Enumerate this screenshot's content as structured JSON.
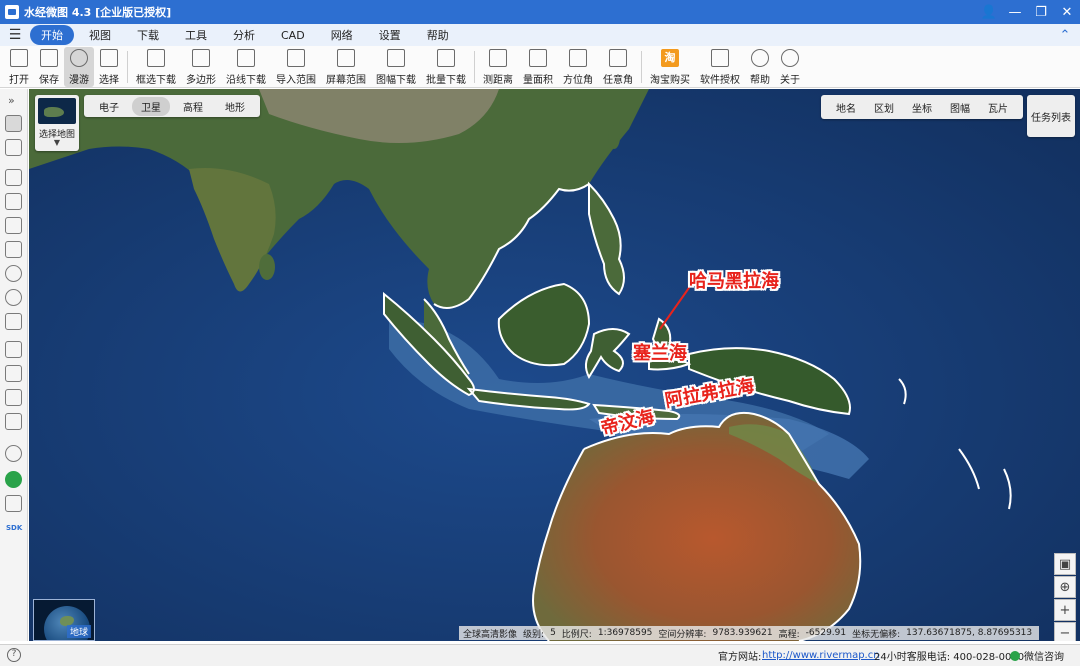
{
  "window": {
    "title": "水经微图 4.3 [企业版已授权]"
  },
  "menu": {
    "items": [
      "开始",
      "视图",
      "下载",
      "工具",
      "分析",
      "CAD",
      "网络",
      "设置",
      "帮助"
    ],
    "active": "开始"
  },
  "toolbar": {
    "items": [
      {
        "label": "打开",
        "icon": "folder-open-icon"
      },
      {
        "label": "保存",
        "icon": "save-icon"
      },
      {
        "label": "漫游",
        "icon": "hand-pan-icon",
        "active": true
      },
      {
        "label": "选择",
        "icon": "pointer-select-icon"
      },
      {
        "label": "框选下载",
        "icon": "rect-download-icon"
      },
      {
        "label": "多边形",
        "icon": "polygon-download-icon"
      },
      {
        "label": "沿线下载",
        "icon": "line-download-icon"
      },
      {
        "label": "导入范围",
        "icon": "import-range-icon"
      },
      {
        "label": "屏幕范围",
        "icon": "screen-range-icon"
      },
      {
        "label": "图幅下载",
        "icon": "sheet-download-icon"
      },
      {
        "label": "批量下载",
        "icon": "batch-download-icon"
      },
      {
        "label": "测距离",
        "icon": "measure-distance-icon"
      },
      {
        "label": "量面积",
        "icon": "measure-area-icon"
      },
      {
        "label": "方位角",
        "icon": "azimuth-icon"
      },
      {
        "label": "任意角",
        "icon": "arbitrary-angle-icon"
      },
      {
        "label": "淘宝购买",
        "icon": "taobao-icon"
      },
      {
        "label": "软件授权",
        "icon": "license-lock-icon"
      },
      {
        "label": "帮助",
        "icon": "help-icon"
      },
      {
        "label": "关于",
        "icon": "about-icon"
      }
    ]
  },
  "map": {
    "basemap_label": "选择地图",
    "map_types": [
      "电子",
      "卫星",
      "高程",
      "地形"
    ],
    "active_map_type": "卫星",
    "layers": [
      "地名",
      "区划",
      "坐标",
      "图幅",
      "瓦片"
    ],
    "task_list": "任务列表",
    "globe_label": "地球",
    "annotations": [
      "哈马黑拉海",
      "塞兰海",
      "阿拉弗拉海",
      "帝汶海"
    ],
    "status": {
      "source": "全球高清影像",
      "level_label": "级别:",
      "level": "5",
      "scale_label": "比例尺:",
      "scale": "1:36978595",
      "resolution_label": "空间分辨率:",
      "resolution": "9783.939621",
      "elevation_label": "高程:",
      "elevation": "-6529.91",
      "offset_label": "坐标无偏移:",
      "coords": "137.63671875, 8.87695313"
    },
    "colors": {
      "deep_ocean": "#173a73",
      "shelf": "#3f6fa8",
      "land_green": "#4b6a3a",
      "land_desert": "#a9532c",
      "annotation_red": "#e8231c"
    }
  },
  "footer": {
    "site_label": "官方网站:",
    "site_url": "http://www.rivermap.cn",
    "hotline": "24小时客服电话: 400-028-0050",
    "wechat": "微信咨询"
  }
}
